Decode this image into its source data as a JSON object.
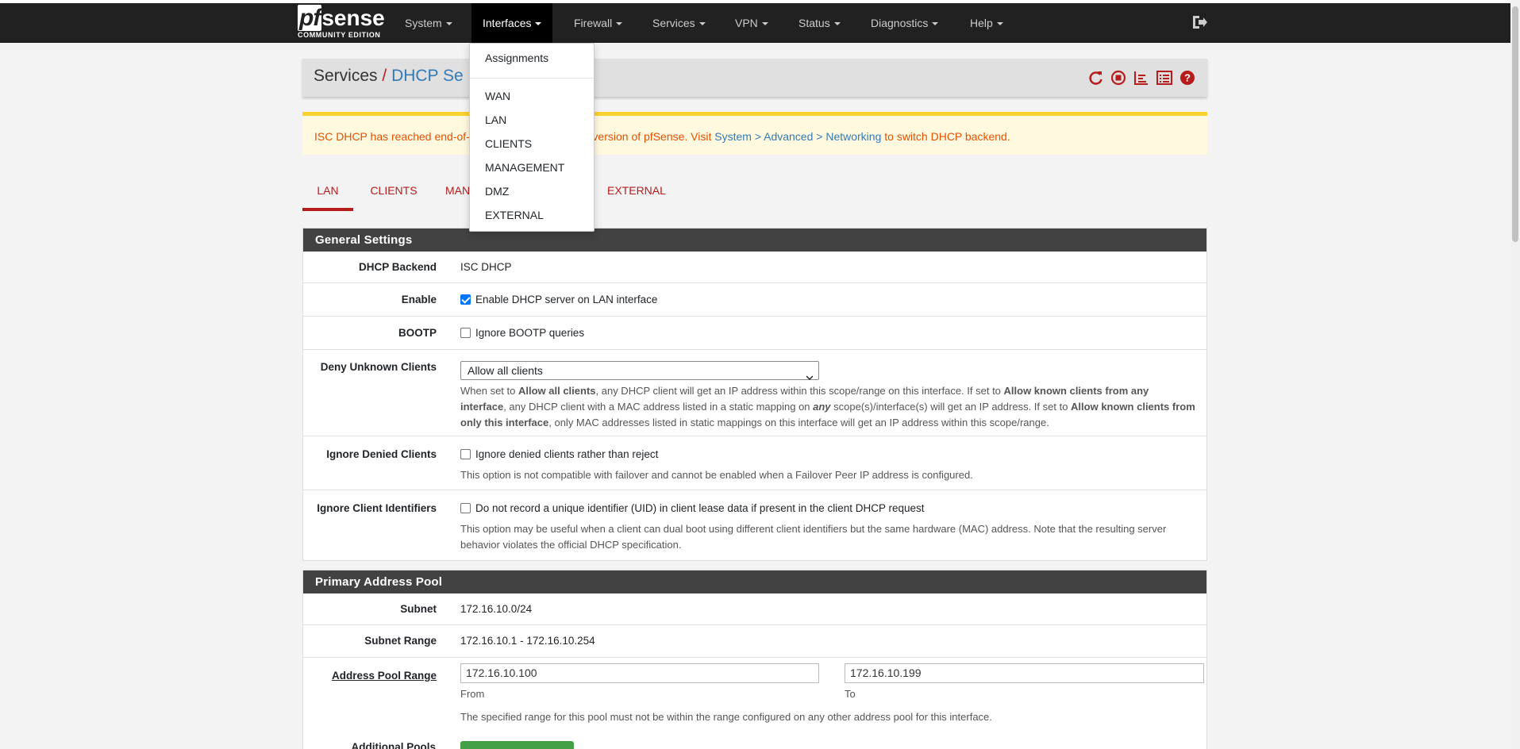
{
  "brand": {
    "name_pf": "pf",
    "name_sense": "sense",
    "edition": "COMMUNITY EDITION"
  },
  "nav": {
    "items": [
      "System",
      "Interfaces",
      "Firewall",
      "Services",
      "VPN",
      "Status",
      "Diagnostics",
      "Help"
    ]
  },
  "dropdown": {
    "items": [
      "Assignments",
      "WAN",
      "LAN",
      "CLIENTS",
      "MANAGEMENT",
      "DMZ",
      "EXTERNAL"
    ]
  },
  "breadcrumb": {
    "section": "Services",
    "separator": "/",
    "page": "DHCP Se"
  },
  "warning": {
    "text_start": "ISC DHCP has reached end-of-li",
    "text_mid": "a future version of pfSense. Visit ",
    "link": "System > Advanced > Networking",
    "text_end": " to switch DHCP backend."
  },
  "tabs": [
    "LAN",
    "CLIENTS",
    "MAN",
    "EXTERNAL"
  ],
  "general": {
    "title": "General Settings",
    "backend_label": "DHCP Backend",
    "backend_value": "ISC DHCP",
    "enable_label": "Enable",
    "enable_text": "Enable DHCP server on LAN interface",
    "enable_checked": true,
    "bootp_label": "BOOTP",
    "bootp_text": "Ignore BOOTP queries",
    "deny_label": "Deny Unknown Clients",
    "deny_value": "Allow all clients",
    "deny_help": {
      "p1": "When set to ",
      "b1": "Allow all clients",
      "p2": ", any DHCP client will get an IP address within this scope/range on this interface. If set to ",
      "b2": "Allow known clients from any interface",
      "p3": ", any DHCP client with a MAC address listed in a static mapping on ",
      "b3": "any",
      "p4": " scope(s)/interface(s) will get an IP address. If set to ",
      "b4": "Allow known clients from only this interface",
      "p5": ", only MAC addresses listed in static mappings on this interface will get an IP address within this scope/range."
    },
    "ignore_denied_label": "Ignore Denied Clients",
    "ignore_denied_text": "Ignore denied clients rather than reject",
    "ignore_denied_help": "This option is not compatible with failover and cannot be enabled when a Failover Peer IP address is configured.",
    "ignore_uid_label": "Ignore Client Identifiers",
    "ignore_uid_text": "Do not record a unique identifier (UID) in client lease data if present in the client DHCP request",
    "ignore_uid_help": "This option may be useful when a client can dual boot using different client identifiers but the same hardware (MAC) address. Note that the resulting server behavior violates the official DHCP specification."
  },
  "pool": {
    "title": "Primary Address Pool",
    "subnet_label": "Subnet",
    "subnet_value": "172.16.10.0/24",
    "range_label": "Subnet Range",
    "range_value": "172.16.10.1 - 172.16.10.254",
    "pool_label": "Address Pool Range",
    "from_value": "172.16.10.100",
    "to_value": "172.16.10.199",
    "from_label": "From",
    "to_label": "To",
    "pool_help": "The specified range for this pool must not be within the range configured on any other address pool for this interface.",
    "additional_label": "Additional Pools"
  },
  "colors": {
    "accent": "#b71c1c",
    "navbar": "#212121",
    "panel_head": "#424242",
    "link": "#337ab7",
    "warning": "#e65100"
  }
}
